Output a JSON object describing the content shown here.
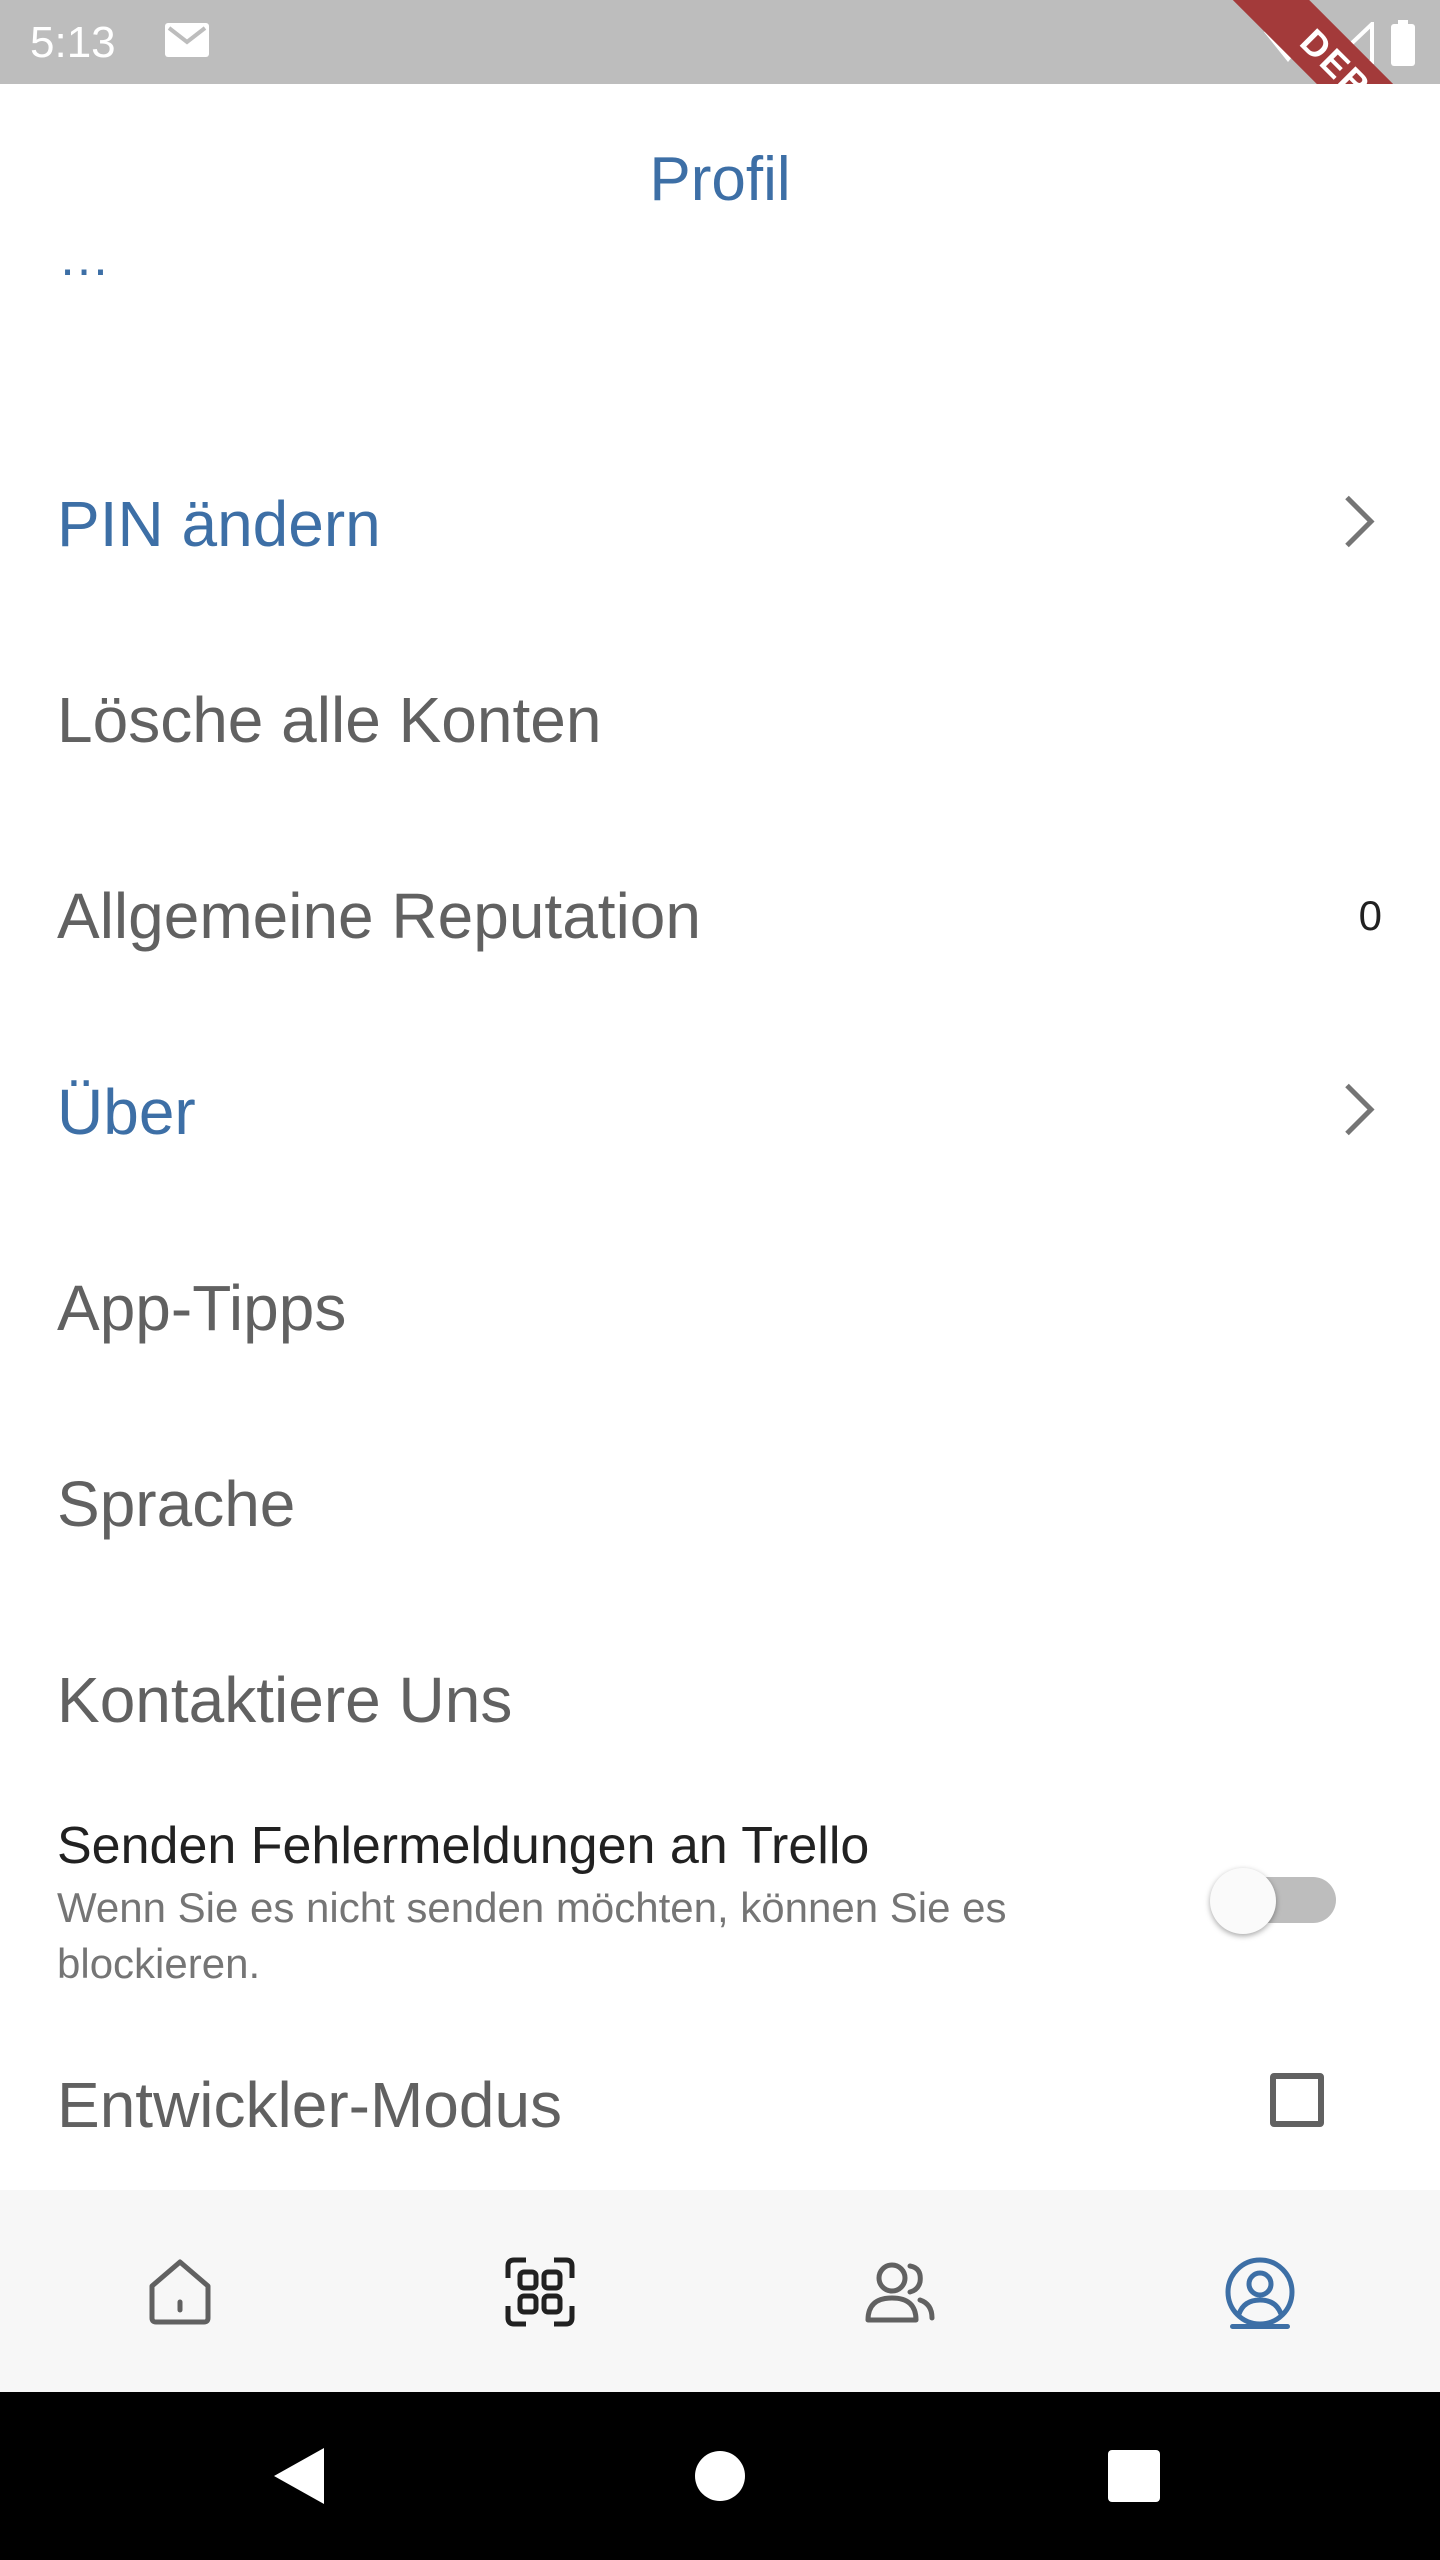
{
  "status_bar": {
    "time": "5:13",
    "icons": [
      "mail-icon",
      "wifi-icon",
      "signal-icon",
      "battery-icon"
    ]
  },
  "debug_banner": "DEBUG",
  "header": {
    "title": "Profil"
  },
  "cutoff_text": "…",
  "rows": [
    {
      "label": "PIN ändern",
      "style": "link",
      "trailing": "chevron-right-icon"
    },
    {
      "label": "Lösche alle Konten",
      "style": "normal"
    },
    {
      "label": "Allgemeine Reputation",
      "style": "normal",
      "value": "0"
    },
    {
      "label": "Über",
      "style": "link",
      "trailing": "chevron-right-icon"
    },
    {
      "label": "App-Tipps",
      "style": "normal"
    },
    {
      "label": "Sprache",
      "style": "normal"
    },
    {
      "label": "Kontaktiere Uns",
      "style": "normal"
    }
  ],
  "error_reports": {
    "title": "Senden Fehlermeldungen an Trello",
    "subtitle": "Wenn Sie es nicht senden möchten, können Sie es blockieren.",
    "enabled": false
  },
  "developer_mode": {
    "label": "Entwickler-Modus",
    "checked": false
  },
  "bottom_nav": {
    "items": [
      {
        "icon": "home-icon",
        "active": false
      },
      {
        "icon": "qr-scan-icon",
        "active": false
      },
      {
        "icon": "contacts-icon",
        "active": false
      },
      {
        "icon": "profile-icon",
        "active": true
      }
    ]
  },
  "colors": {
    "accent": "#3d6fa6",
    "text": "#616161",
    "status_bar": "#bdbdbd",
    "nav_bg": "#f7f7f7"
  }
}
